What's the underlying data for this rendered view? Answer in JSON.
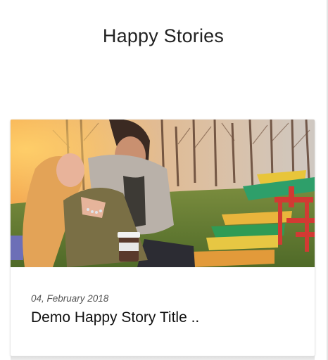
{
  "page": {
    "title": "Happy Stories"
  },
  "story": {
    "date": "04, February 2018",
    "title": "Demo Happy Story Title ..",
    "image_icon": "photo-couple-laughing-in-park"
  },
  "colors": {
    "background": "#ffffff",
    "title_text": "#222222",
    "date_text": "#555555"
  }
}
